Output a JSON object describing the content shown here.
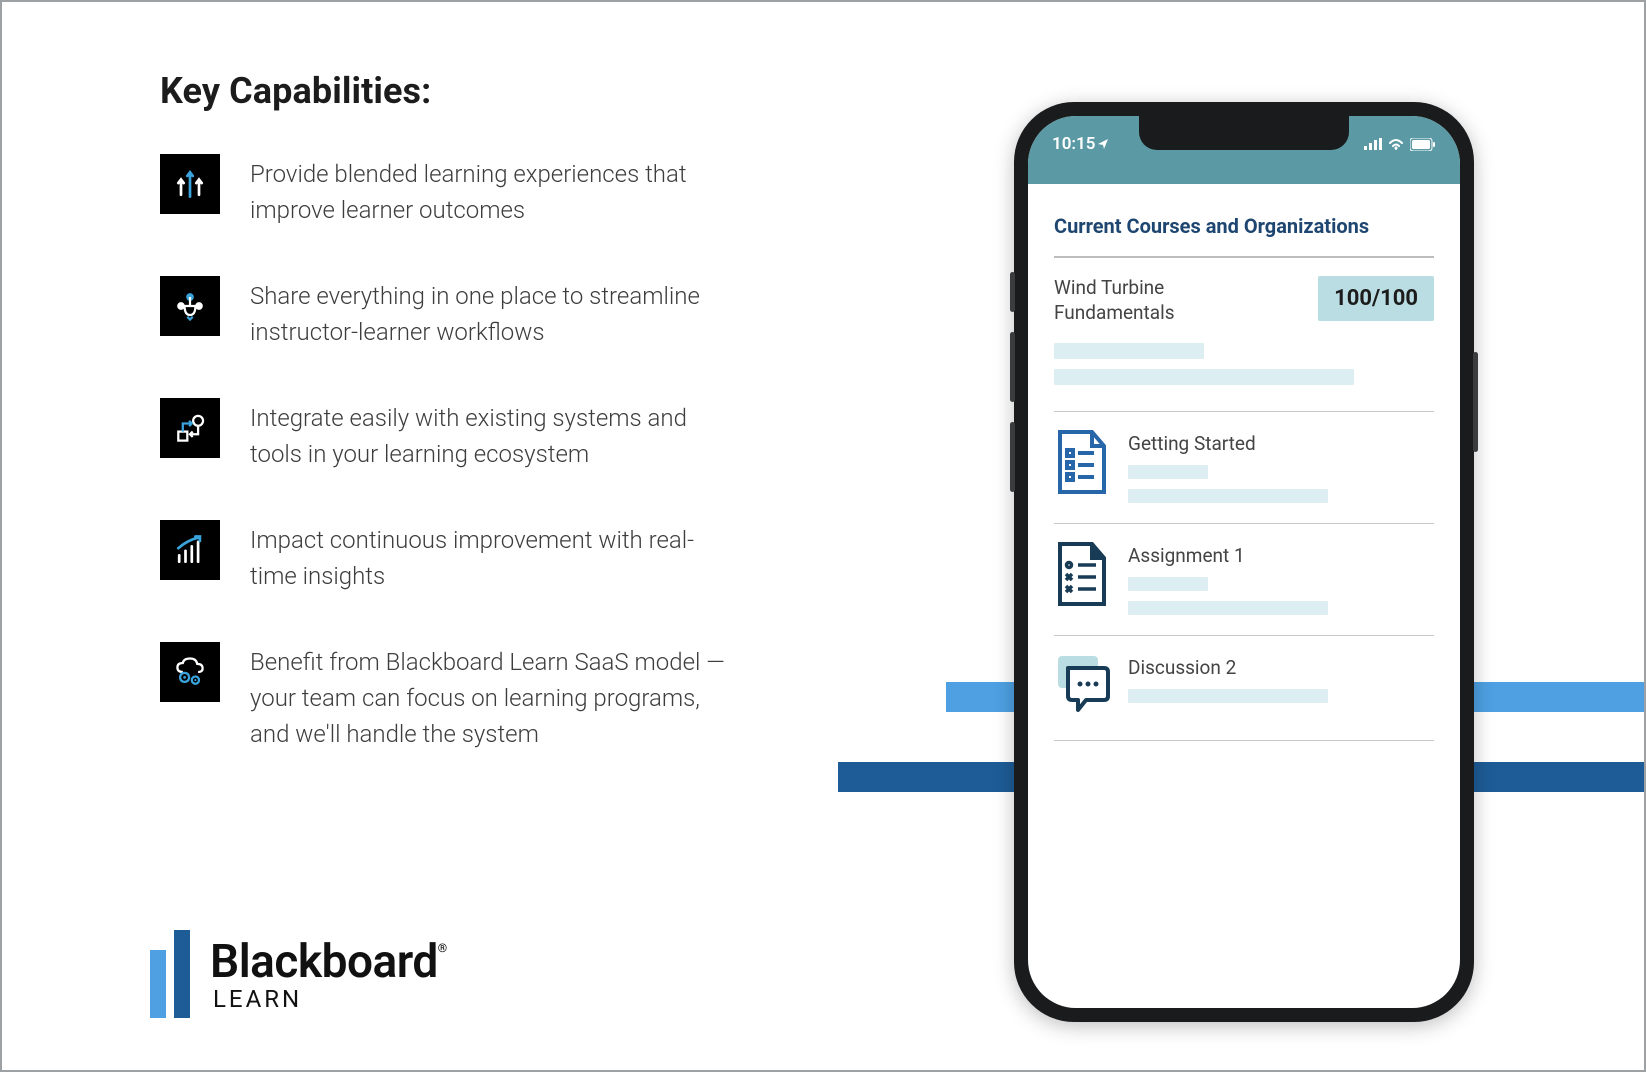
{
  "heading": "Key Capabilities:",
  "capabilities": [
    {
      "text": "Provide blended learning experiences that improve learner outcomes"
    },
    {
      "text": "Share everything in one place to streamline instructor-learner workflows"
    },
    {
      "text": "Integrate easily with existing systems and tools in your learning ecosystem"
    },
    {
      "text": "Impact continuous improvement with real-time insights"
    },
    {
      "text": "Benefit from Blackboard Learn SaaS model — your team can focus on learning programs, and we'll handle the system"
    }
  ],
  "logo": {
    "brand": "Blackboard",
    "registered": "®",
    "sub": "LEARN"
  },
  "phone": {
    "status": {
      "time": "10:15"
    },
    "heading": "Current Courses and Organizations",
    "course": {
      "name": "Wind Turbine Fundamentals",
      "score": "100/100"
    },
    "items": [
      {
        "title": "Getting Started"
      },
      {
        "title": "Assignment 1"
      },
      {
        "title": "Discussion 2"
      }
    ]
  }
}
